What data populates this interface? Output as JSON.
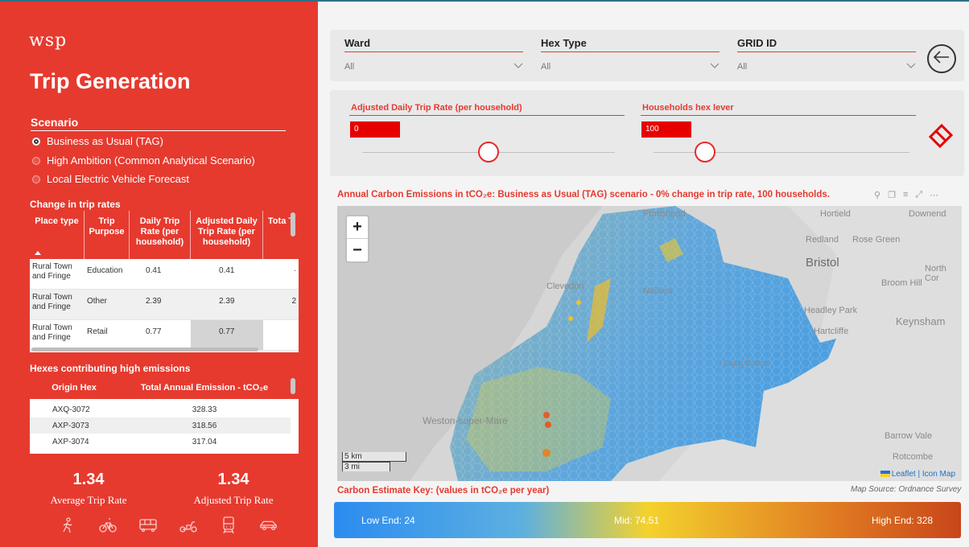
{
  "brand": {
    "logo": "wsp",
    "title": "Trip Generation",
    "accent": "#e63a2f"
  },
  "scenario": {
    "heading": "Scenario",
    "options": [
      {
        "label": "Business as Usual (TAG)",
        "selected": true
      },
      {
        "label": "High Ambition (Common Analytical Scenario)",
        "selected": false
      },
      {
        "label": "Local Electric Vehicle Forecast",
        "selected": false
      }
    ]
  },
  "trip_rates": {
    "heading": "Change in trip rates",
    "columns": [
      "Place type",
      "Trip Purpose",
      "Daily Trip Rate (per household)",
      "Adjusted Daily Trip Rate (per household)",
      "Tota T"
    ],
    "rows": [
      [
        "Rural Town and Fringe",
        "Education",
        "0.41",
        "0.41",
        "·"
      ],
      [
        "Rural Town and Fringe",
        "Other",
        "2.39",
        "2.39",
        "2"
      ],
      [
        "Rural Town and Fringe",
        "Retail",
        "0.77",
        "0.77",
        ""
      ]
    ]
  },
  "hexes": {
    "heading": "Hexes contributing high emissions",
    "columns": [
      "Origin Hex",
      "Total Annual Emission - tCO₂e"
    ],
    "rows": [
      [
        "AXQ-3072",
        "328.33"
      ],
      [
        "AXP-3073",
        "318.56"
      ],
      [
        "AXP-3074",
        "317.04"
      ]
    ]
  },
  "metrics": {
    "avg_value": "1.34",
    "avg_label": "Average Trip Rate",
    "adj_value": "1.34",
    "adj_label": "Adjusted Trip Rate"
  },
  "transport_icons": [
    "walk-icon",
    "bicycle-icon",
    "bus-icon",
    "scooter-icon",
    "train-icon",
    "car-icon"
  ],
  "filters": {
    "ward": {
      "label": "Ward",
      "value": "All"
    },
    "hex_type": {
      "label": "Hex Type",
      "value": "All"
    },
    "grid_id": {
      "label": "GRID ID",
      "value": "All"
    }
  },
  "sliders": {
    "trip_rate": {
      "label": "Adjusted Daily Trip Rate (per household)",
      "value": "0",
      "position": 0.5
    },
    "households": {
      "label": "Households hex lever",
      "value": "100",
      "position": 0.5
    }
  },
  "map": {
    "title": "Annual Carbon Emissions in tCO₂e: Business as Usual (TAG) scenario - 0% change in trip rate, 100 households.",
    "zoom_in": "+",
    "zoom_out": "−",
    "scale_km": "5 km",
    "scale_mi": "3 mi",
    "attribution": "Leaflet | Icon Map",
    "labels": [
      "Portishead",
      "Hortield",
      "Downend",
      "Redland",
      "Rose Green",
      "Bristol",
      "North Cor",
      "Broom Hill",
      "Clevedon",
      "Nailsea",
      "Headley Park",
      "Keynsham",
      "Hartcliffe",
      "Weston-super-Mare",
      "Barrow Vale",
      "Rotcombe",
      "Long Cross"
    ]
  },
  "key": {
    "title": "Carbon Estimate Key: (values in tCO₂e per year)",
    "source": "Map Source: Ordnance Survey",
    "low": "Low End: 24",
    "mid": "Mid: 74.51",
    "high": "High End: 328"
  }
}
